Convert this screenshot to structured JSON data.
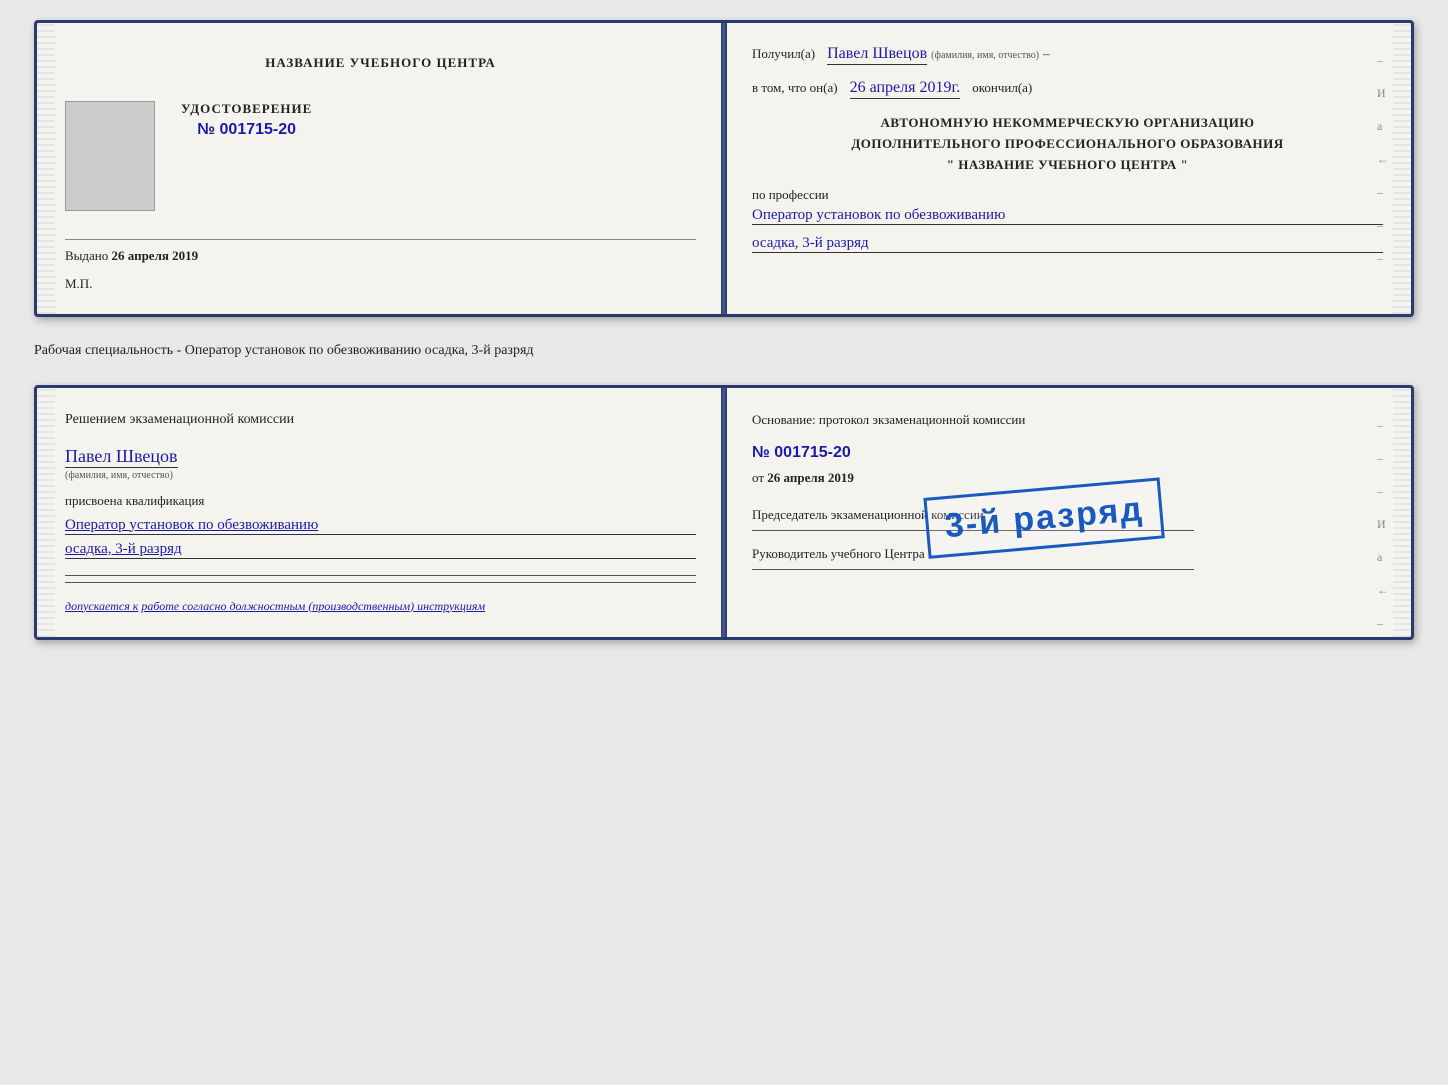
{
  "card1": {
    "left": {
      "title": "НАЗВАНИЕ УЧЕБНОГО ЦЕНТРА",
      "cert_label": "УДОСТОВЕРЕНИЕ",
      "cert_number": "№ 001715-20",
      "issued_prefix": "Выдано",
      "issued_date": "26 апреля 2019",
      "mp_label": "М.П."
    },
    "right": {
      "received_prefix": "Получил(а)",
      "recipient_name": "Павел Швецов",
      "recipient_sublabel": "(фамилия, имя, отчество)",
      "dash": "–",
      "in_that_prefix": "в том, что он(а)",
      "completion_date": "26 апреля 2019г.",
      "finished_label": "окончил(а)",
      "org_line1": "АВТОНОМНУЮ НЕКОММЕРЧЕСКУЮ ОРГАНИЗАЦИЮ",
      "org_line2": "ДОПОЛНИТЕЛЬНОГО ПРОФЕССИОНАЛЬНОГО ОБРАЗОВАНИЯ",
      "org_line3": "\"   НАЗВАНИЕ УЧЕБНОГО ЦЕНТРА   \"",
      "profession_prefix": "по профессии",
      "profession_value": "Оператор установок по обезвоживанию",
      "rank_value": "осадка, 3-й разряд"
    }
  },
  "separator": {
    "text": "Рабочая специальность - Оператор установок по обезвоживанию осадка, 3-й разряд"
  },
  "card2": {
    "left": {
      "decision_title": "Решением экзаменационной комиссии",
      "name": "Павел Швецов",
      "name_sublabel": "(фамилия, имя, отчество)",
      "assigned_label": "присвоена квалификация",
      "profession1": "Оператор установок по обезвоживанию",
      "profession2": "осадка, 3-й разряд",
      "admitted_prefix": "допускается к",
      "admitted_value": "работе согласно должностным (производственным) инструкциям"
    },
    "right": {
      "basis_title": "Основание: протокол экзаменационной комиссии",
      "protocol_number": "№ 001715-20",
      "date_prefix": "от",
      "protocol_date": "26 апреля 2019",
      "chairman_label": "Председатель экзаменационной комиссии",
      "director_label": "Руководитель учебного Центра"
    },
    "stamp": {
      "text": "3-й разряд"
    }
  },
  "side_marks": {
    "items": [
      "И",
      "а",
      "←",
      "–",
      "–",
      "–",
      "–"
    ]
  }
}
